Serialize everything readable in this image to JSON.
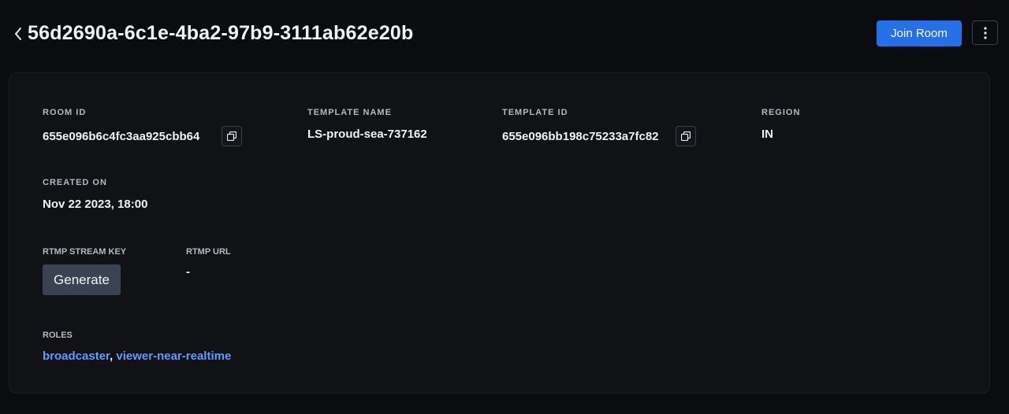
{
  "header": {
    "title": "56d2690a-6c1e-4ba2-97b9-3111ab62e20b",
    "back_icon": "chevron-left-icon",
    "join_label": "Join Room",
    "more_icon": "kebab-menu-icon",
    "accent": "#2570e8"
  },
  "details": {
    "room_id": {
      "label": "ROOM ID",
      "value": "655e096b6c4fc3aa925cbb64"
    },
    "template_name": {
      "label": "TEMPLATE NAME",
      "value": "LS-proud-sea-737162"
    },
    "template_id": {
      "label": "TEMPLATE ID",
      "value": "655e096bb198c75233a7fc82"
    },
    "region": {
      "label": "REGION",
      "value": "IN"
    },
    "created_on": {
      "label": "CREATED ON",
      "value": "Nov 22 2023, 18:00"
    },
    "rtmp_stream_key": {
      "label": "RTMP STREAM KEY",
      "button": "Generate"
    },
    "rtmp_url": {
      "label": "RTMP URL",
      "value": "-"
    },
    "roles": {
      "label": "ROLES",
      "items": [
        "broadcaster",
        "viewer-near-realtime"
      ],
      "separator": ", ",
      "link_color": "#5e9bff"
    }
  }
}
